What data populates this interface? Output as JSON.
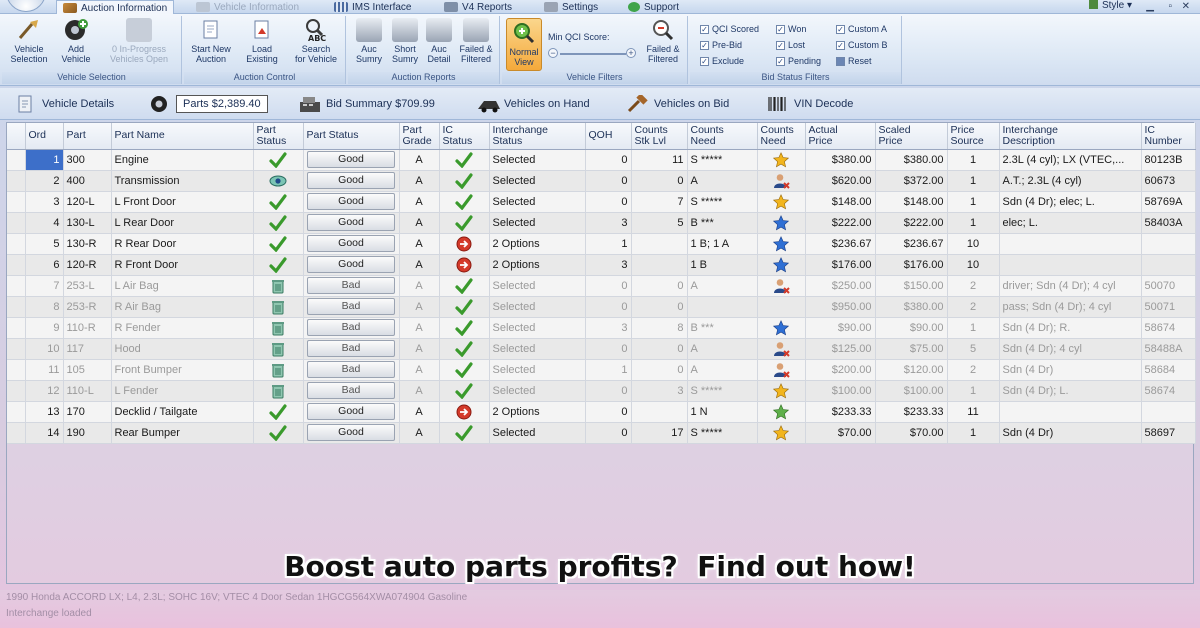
{
  "ribbon_tabs": [
    {
      "label": "Auction Information",
      "icon": "gavel-icon",
      "active": true
    },
    {
      "label": "Vehicle Information",
      "icon": "car-icon",
      "disabled": true
    },
    {
      "label": "IMS Interface",
      "icon": "grid-icon"
    },
    {
      "label": "V4 Reports",
      "icon": "report-icon"
    },
    {
      "label": "Settings",
      "icon": "wrench-icon"
    },
    {
      "label": "Support",
      "icon": "question-icon"
    }
  ],
  "style_menu": "Style",
  "ribbon": {
    "vehicle_selection": {
      "label": "Vehicle Selection",
      "vehicle_selection": "Vehicle\nSelection",
      "add_vehicle": "Add\nVehicle",
      "in_progress": "0 In-Progress\nVehicles Open"
    },
    "auction_control": {
      "label": "Auction Control",
      "start_new": "Start New\nAuction",
      "load_existing": "Load\nExisting",
      "search": "Search\nfor Vehicle"
    },
    "auction_reports": {
      "label": "Auction Reports",
      "auc_sumry": "Auc\nSumry",
      "short_sumry": "Short\nSumry",
      "auc_detail": "Auc\nDetail",
      "failed_filtered": "Failed &\nFiltered"
    },
    "vehicle_filters": {
      "label": "Vehicle Filters",
      "normal_view": "Normal\nView",
      "min_qci": "Min QCI Score:",
      "failed_filtered": "Failed &\nFiltered"
    },
    "bid_status_filters": {
      "label": "Bid Status Filters",
      "qci_scored": "QCI Scored",
      "pre_bid": "Pre-Bid",
      "exclude": "Exclude",
      "won": "Won",
      "lost": "Lost",
      "pending": "Pending",
      "custom_a": "Custom A",
      "custom_b": "Custom B",
      "reset": "Reset"
    }
  },
  "subtabs": [
    {
      "label": "Vehicle Details",
      "icon": "clipboard-icon"
    },
    {
      "label": "Parts $2,389.40",
      "icon": "tire-icon",
      "active": true
    },
    {
      "label": "Bid Summary $709.99",
      "icon": "cash-register-icon"
    },
    {
      "label": "Vehicles on Hand",
      "icon": "car-lift-icon"
    },
    {
      "label": "Vehicles on Bid",
      "icon": "gavel-icon"
    },
    {
      "label": "VIN Decode",
      "icon": "barcode-icon"
    }
  ],
  "grid": {
    "headers": [
      "Ord",
      "Part",
      "Part Name",
      "Part\nStatus",
      "Part Status",
      "Part\nGrade",
      "IC\nStatus",
      "Interchange\nStatus",
      "QOH",
      "Counts\nStk Lvl",
      "Counts\nNeed",
      "Counts\nNeed",
      "Actual\nPrice",
      "Scaled\nPrice",
      "Price\nSource",
      "Interchange\nDescription",
      "IC\nNumber"
    ],
    "rows": [
      {
        "ord": "1",
        "part": "300",
        "name": "Engine",
        "pstatus_icon": "check",
        "status": "Good",
        "grade": "A",
        "ic_icon": "check",
        "ic_status": "Selected",
        "qoh": "0",
        "stk": "11",
        "need": "S *****",
        "need_icon": "gold-star",
        "actual": "$380.00",
        "scaled": "$380.00",
        "src": "1",
        "desc": "2.3L (4 cyl); LX (VTEC,...",
        "icnum": "80123B",
        "dim": false
      },
      {
        "ord": "2",
        "part": "400",
        "name": "Transmission",
        "pstatus_icon": "eye",
        "status": "Good",
        "grade": "A",
        "ic_icon": "check",
        "ic_status": "Selected",
        "qoh": "0",
        "stk": "0",
        "need": "A",
        "need_icon": "person-x",
        "actual": "$620.00",
        "scaled": "$372.00",
        "src": "1",
        "desc": "A.T.; 2.3L (4 cyl)",
        "icnum": "60673",
        "dim": false
      },
      {
        "ord": "3",
        "part": "120-L",
        "name": "L Front Door",
        "pstatus_icon": "check",
        "status": "Good",
        "grade": "A",
        "ic_icon": "check",
        "ic_status": "Selected",
        "qoh": "0",
        "stk": "7",
        "need": "S *****",
        "need_icon": "gold-star",
        "actual": "$148.00",
        "scaled": "$148.00",
        "src": "1",
        "desc": "Sdn (4 Dr); elec; L.",
        "icnum": "58769A",
        "dim": false
      },
      {
        "ord": "4",
        "part": "130-L",
        "name": "L Rear Door",
        "pstatus_icon": "check",
        "status": "Good",
        "grade": "A",
        "ic_icon": "check",
        "ic_status": "Selected",
        "qoh": "3",
        "stk": "5",
        "need": "B ***",
        "need_icon": "blue-star",
        "actual": "$222.00",
        "scaled": "$222.00",
        "src": "1",
        "desc": "elec; L.",
        "icnum": "58403A",
        "dim": false
      },
      {
        "ord": "5",
        "part": "130-R",
        "name": "R Rear Door",
        "pstatus_icon": "check",
        "status": "Good",
        "grade": "A",
        "ic_icon": "arrow",
        "ic_status": "2 Options",
        "qoh": "1",
        "stk": "",
        "need": "1 B; 1 A",
        "need_icon": "blue-star",
        "actual": "$236.67",
        "scaled": "$236.67",
        "src": "10",
        "desc": "",
        "icnum": "",
        "dim": false
      },
      {
        "ord": "6",
        "part": "120-R",
        "name": "R Front Door",
        "pstatus_icon": "check",
        "status": "Good",
        "grade": "A",
        "ic_icon": "arrow",
        "ic_status": "2 Options",
        "qoh": "3",
        "stk": "",
        "need": "1 B",
        "need_icon": "blue-star",
        "actual": "$176.00",
        "scaled": "$176.00",
        "src": "10",
        "desc": "",
        "icnum": "",
        "dim": false
      },
      {
        "ord": "7",
        "part": "253-L",
        "name": "L Air Bag",
        "pstatus_icon": "trash",
        "status": "Bad",
        "grade": "A",
        "ic_icon": "check",
        "ic_status": "Selected",
        "qoh": "0",
        "stk": "0",
        "need": "A",
        "need_icon": "person-x",
        "actual": "$250.00",
        "scaled": "$150.00",
        "src": "2",
        "desc": "driver; Sdn (4 Dr); 4 cyl",
        "icnum": "50070",
        "dim": true
      },
      {
        "ord": "8",
        "part": "253-R",
        "name": "R Air Bag",
        "pstatus_icon": "trash",
        "status": "Bad",
        "grade": "A",
        "ic_icon": "check",
        "ic_status": "Selected",
        "qoh": "0",
        "stk": "0",
        "need": "",
        "need_icon": "",
        "actual": "$950.00",
        "scaled": "$380.00",
        "src": "2",
        "desc": "pass; Sdn (4 Dr); 4 cyl",
        "icnum": "50071",
        "dim": true
      },
      {
        "ord": "9",
        "part": "110-R",
        "name": "R Fender",
        "pstatus_icon": "trash",
        "status": "Bad",
        "grade": "A",
        "ic_icon": "check",
        "ic_status": "Selected",
        "qoh": "3",
        "stk": "8",
        "need": "B ***",
        "need_icon": "blue-star",
        "actual": "$90.00",
        "scaled": "$90.00",
        "src": "1",
        "desc": "Sdn (4 Dr); R.",
        "icnum": "58674",
        "dim": true
      },
      {
        "ord": "10",
        "part": "117",
        "name": "Hood",
        "pstatus_icon": "trash",
        "status": "Bad",
        "grade": "A",
        "ic_icon": "check",
        "ic_status": "Selected",
        "qoh": "0",
        "stk": "0",
        "need": "A",
        "need_icon": "person-x",
        "actual": "$125.00",
        "scaled": "$75.00",
        "src": "5",
        "desc": "Sdn (4 Dr); 4 cyl",
        "icnum": "58488A",
        "dim": true
      },
      {
        "ord": "11",
        "part": "105",
        "name": "Front Bumper",
        "pstatus_icon": "trash",
        "status": "Bad",
        "grade": "A",
        "ic_icon": "check",
        "ic_status": "Selected",
        "qoh": "1",
        "stk": "0",
        "need": "A",
        "need_icon": "person-x",
        "actual": "$200.00",
        "scaled": "$120.00",
        "src": "2",
        "desc": "Sdn (4 Dr)",
        "icnum": "58684",
        "dim": true
      },
      {
        "ord": "12",
        "part": "110-L",
        "name": "L Fender",
        "pstatus_icon": "trash",
        "status": "Bad",
        "grade": "A",
        "ic_icon": "check",
        "ic_status": "Selected",
        "qoh": "0",
        "stk": "3",
        "need": "S *****",
        "need_icon": "gold-star",
        "actual": "$100.00",
        "scaled": "$100.00",
        "src": "1",
        "desc": "Sdn (4 Dr); L.",
        "icnum": "58674",
        "dim": true
      },
      {
        "ord": "13",
        "part": "170",
        "name": "Decklid / Tailgate",
        "pstatus_icon": "check",
        "status": "Good",
        "grade": "A",
        "ic_icon": "arrow",
        "ic_status": "2 Options",
        "qoh": "0",
        "stk": "",
        "need": "1 N",
        "need_icon": "green-star",
        "actual": "$233.33",
        "scaled": "$233.33",
        "src": "11",
        "desc": "",
        "icnum": "",
        "dim": false
      },
      {
        "ord": "14",
        "part": "190",
        "name": "Rear Bumper",
        "pstatus_icon": "check",
        "status": "Good",
        "grade": "A",
        "ic_icon": "check",
        "ic_status": "Selected",
        "qoh": "0",
        "stk": "17",
        "need": "S *****",
        "need_icon": "gold-star",
        "actual": "$70.00",
        "scaled": "$70.00",
        "src": "1",
        "desc": "Sdn (4 Dr)",
        "icnum": "58697",
        "dim": false
      }
    ]
  },
  "statusbar": {
    "vehicle": "1990   Honda   ACCORD   LX; L4, 2.3L; SOHC 16V; VTEC   4 Door Sedan   1HGCG564XWA074904   Gasoline",
    "sub": "Interchange loaded"
  },
  "overlay_caption": "Boost auto parts profits?  Find out how!",
  "colors": {
    "accent": "#3d6fc9",
    "check": "#3a9a2c",
    "arrow": "#d43a2a",
    "star_gold": "#f2b51d",
    "star_blue": "#2f6fd4"
  }
}
